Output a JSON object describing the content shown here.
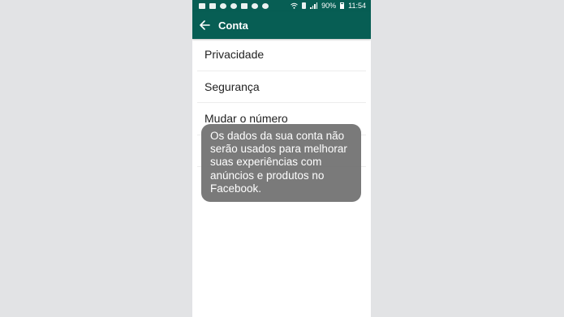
{
  "statusbar": {
    "battery": "90%",
    "time": "11:54"
  },
  "appbar": {
    "title": "Conta",
    "back_icon": "arrow-left-icon"
  },
  "menu": {
    "items": [
      {
        "label": "Privacidade"
      },
      {
        "label": "Segurança"
      },
      {
        "label": "Mudar o número"
      },
      {
        "label": ""
      }
    ]
  },
  "toast": {
    "text": "Os dados da sua conta não serão usados para melhorar suas experiências com anúncios e produtos no Facebook."
  },
  "colors": {
    "header": "#075e54",
    "toast": "#767676"
  }
}
